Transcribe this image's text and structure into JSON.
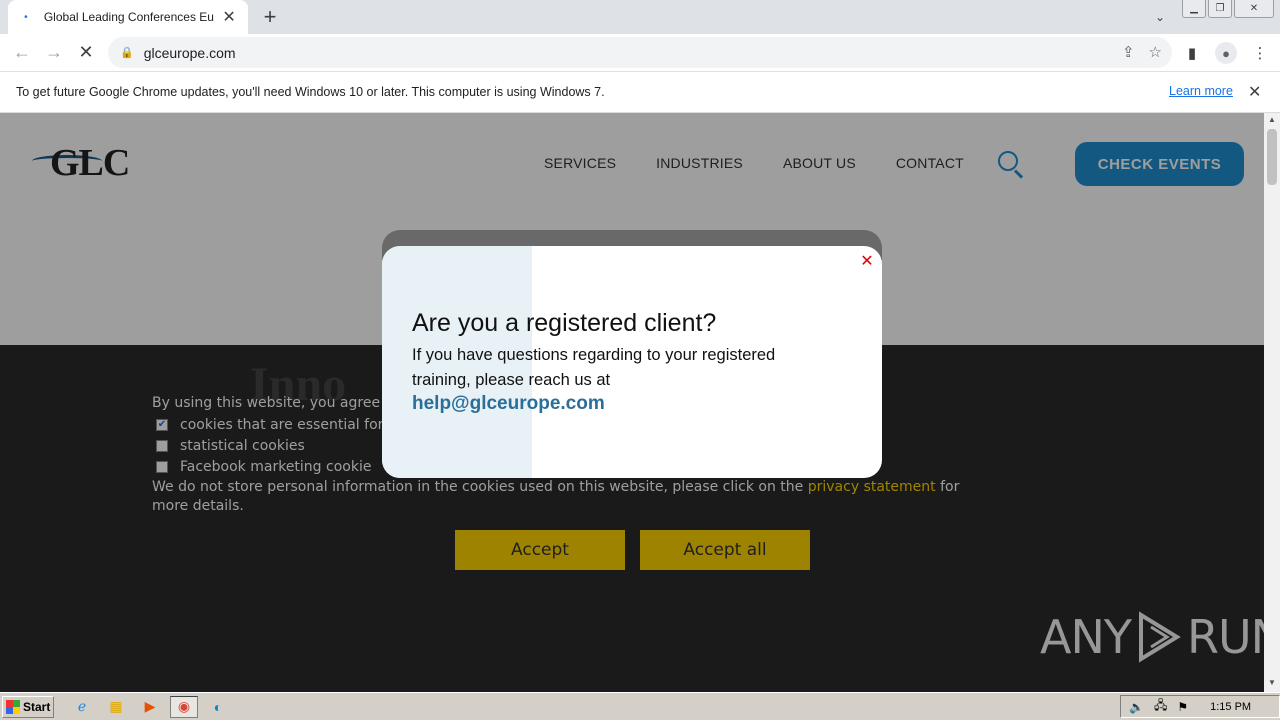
{
  "browser": {
    "tab_title": "Global Leading Conferences Europe",
    "url": "glceurope.com",
    "infobar_text": "To get future Google Chrome updates, you'll need Windows 10 or later. This computer is using Windows 7.",
    "infobar_link": "Learn more"
  },
  "site": {
    "logo_text": "GLC",
    "nav": [
      "SERVICES",
      "INDUSTRIES",
      "ABOUT US",
      "CONTACT"
    ],
    "cta": "CHECK EVENTS",
    "hero_heading": "Inno"
  },
  "cookie": {
    "intro": "By using this website, you agree",
    "options": [
      {
        "label": "cookies that are essential for op",
        "checked": true
      },
      {
        "label": "statistical cookies",
        "checked": false
      },
      {
        "label": "Facebook marketing cookie",
        "checked": false
      }
    ],
    "note_before": "We do not store personal information in the cookies used on this website, please click on the",
    "note_link": "privacy statement",
    "note_after": "for more details.",
    "accept": "Accept",
    "accept_all": "Accept all"
  },
  "modal": {
    "title": "Are you a registered client?",
    "text": "If you have questions regarding to your registered training, please reach us at",
    "email": "help@glceurope.com"
  },
  "watermark": {
    "left": "ANY",
    "right": "RUN"
  },
  "taskbar": {
    "start": "Start",
    "clock": "1:15 PM"
  },
  "colors": {
    "brand_blue": "#1f8fd1",
    "cookie_yellow": "#ffd400",
    "modal_email": "#2a6f9a"
  }
}
